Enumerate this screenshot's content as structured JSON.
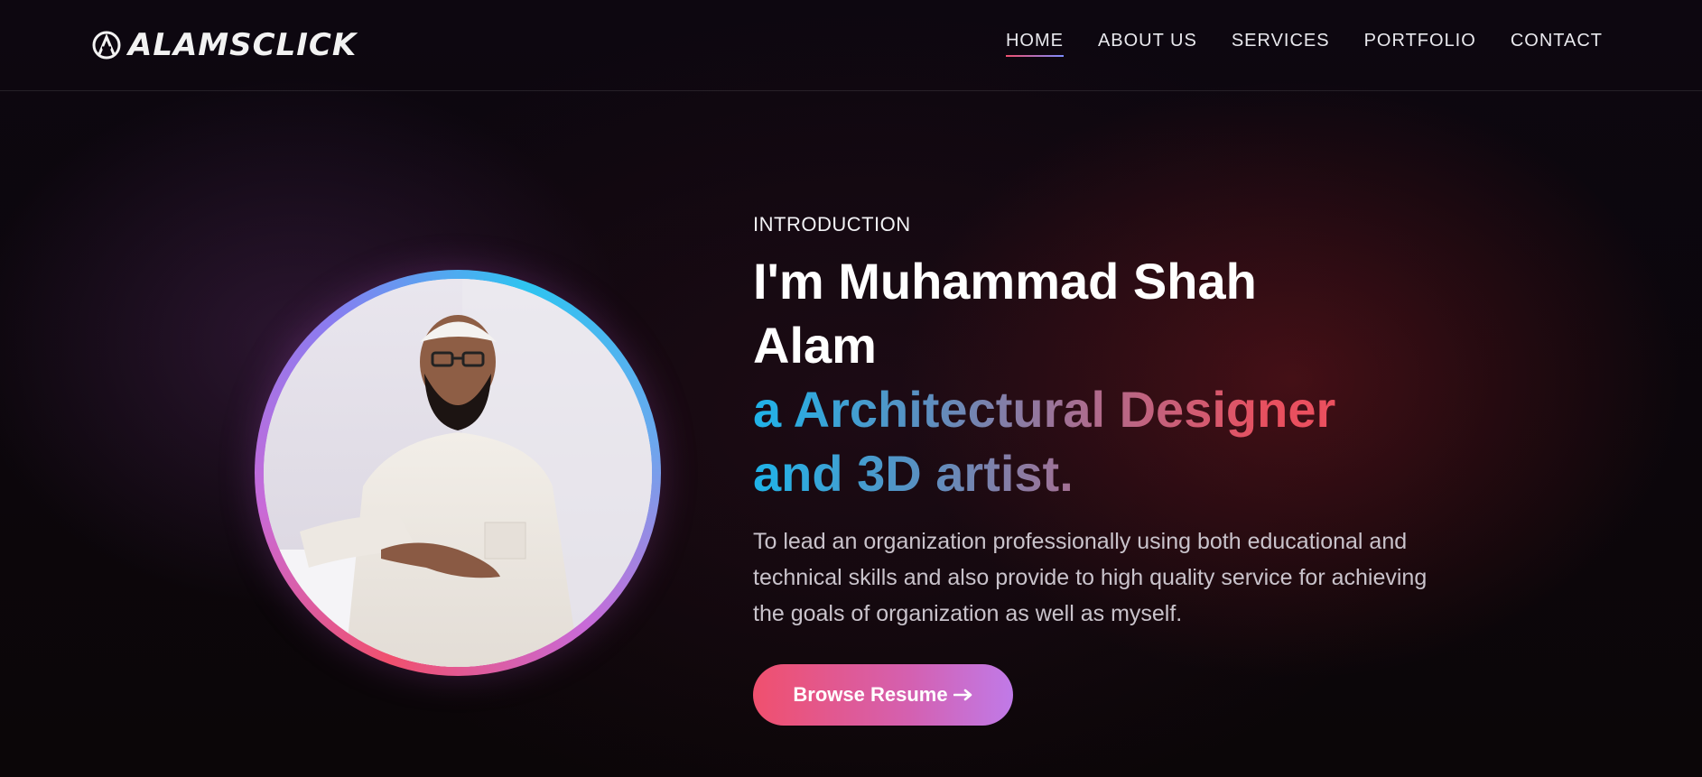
{
  "header": {
    "logo_text": "ALAMSCLICK",
    "nav": [
      {
        "label": "HOME",
        "active": true
      },
      {
        "label": "ABOUT US",
        "active": false
      },
      {
        "label": "SERVICES",
        "active": false
      },
      {
        "label": "PORTFOLIO",
        "active": false
      },
      {
        "label": "CONTACT",
        "active": false
      }
    ]
  },
  "hero": {
    "eyebrow": "INTRODUCTION",
    "title": "I'm Muhammad Shah Alam",
    "subtitle": "a Architectural Designer and 3D artist.",
    "description": "To lead an organization professionally using both educational and technical skills and also provide to high quality service for achieving the goals of organization as well as myself.",
    "cta_label": "Browse Resume",
    "cta_icon": "arrow-right-icon"
  },
  "colors": {
    "accent_red": "#f0506e",
    "accent_blue": "#2ec4f0",
    "accent_purple": "#c07ae8"
  }
}
